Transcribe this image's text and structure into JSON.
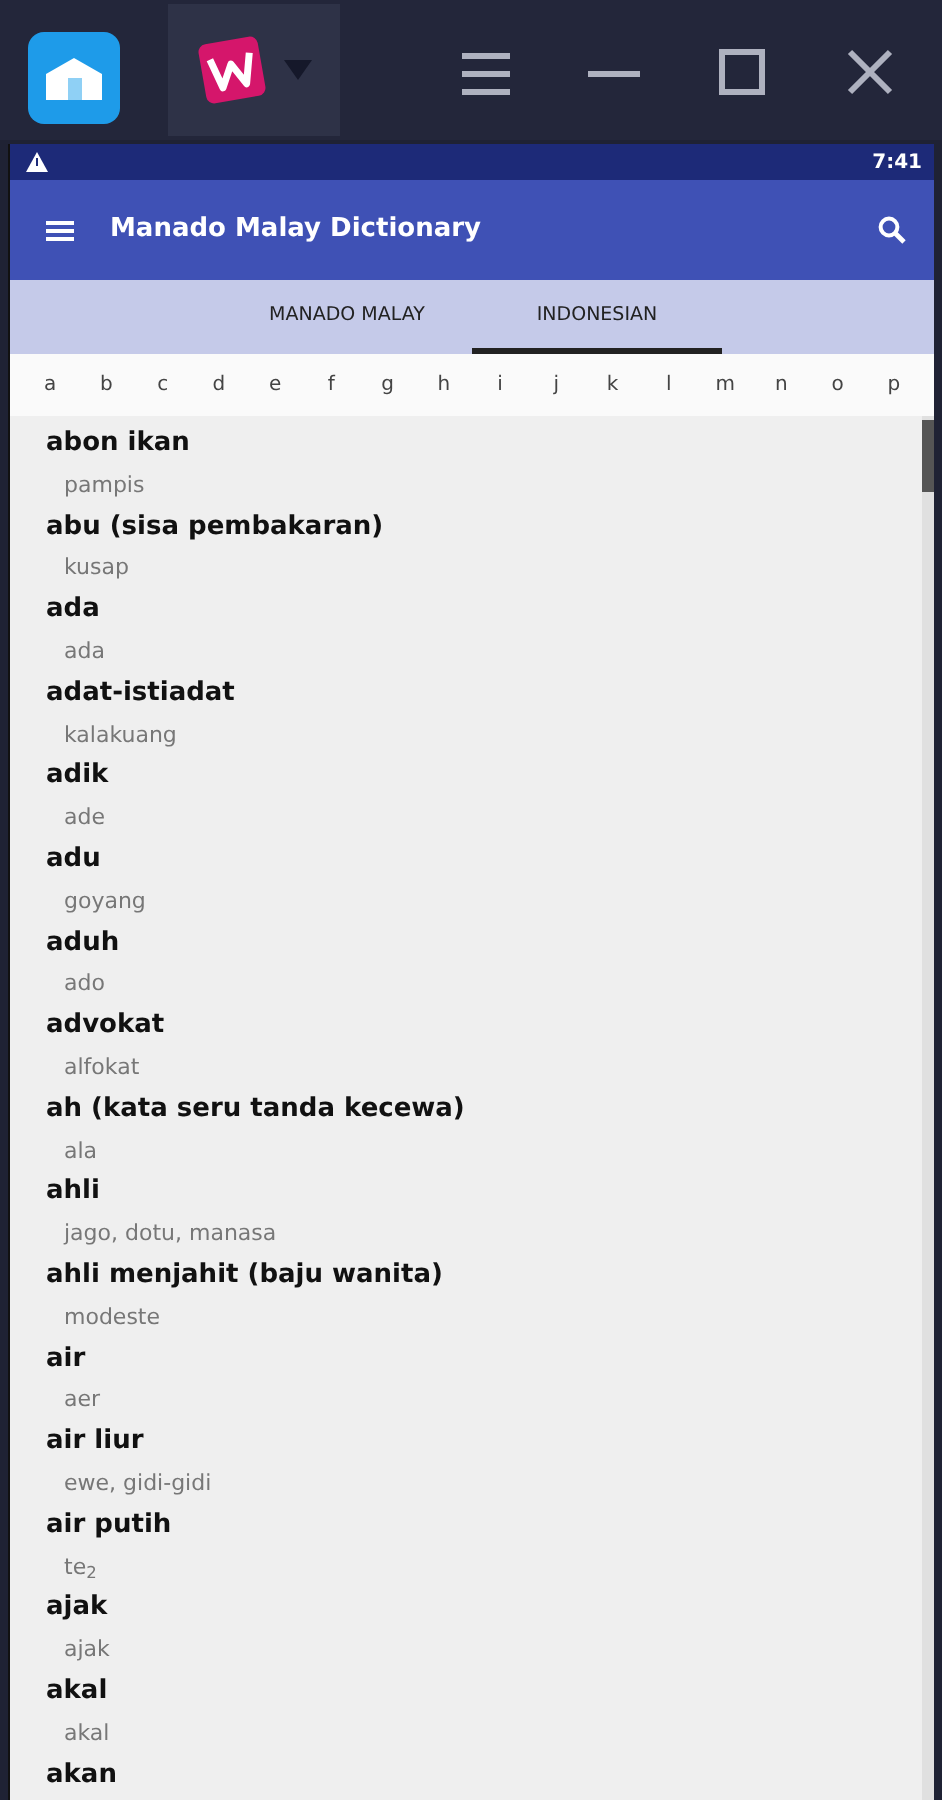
{
  "status_bar": {
    "time": "7:41"
  },
  "app_bar": {
    "title": "Manado Malay Dictionary"
  },
  "tabs": [
    {
      "label": "MANADO MALAY",
      "selected": false
    },
    {
      "label": "INDONESIAN",
      "selected": true
    }
  ],
  "letters": [
    "a",
    "b",
    "c",
    "d",
    "e",
    "f",
    "g",
    "h",
    "i",
    "j",
    "k",
    "l",
    "m",
    "n",
    "o",
    "p"
  ],
  "entries": [
    {
      "word": "abon ikan",
      "translation": "pampis"
    },
    {
      "word": "abu (sisa pembakaran)",
      "translation": "kusap"
    },
    {
      "word": "ada",
      "translation": "ada"
    },
    {
      "word": "adat-istiadat",
      "translation": "kalakuang"
    },
    {
      "word": "adik",
      "translation": "ade"
    },
    {
      "word": "adu",
      "translation": "goyang"
    },
    {
      "word": "aduh",
      "translation": "ado"
    },
    {
      "word": "advokat",
      "translation": "alfokat"
    },
    {
      "word": "ah (kata seru tanda kecewa)",
      "translation": "ala"
    },
    {
      "word": "ahli",
      "translation": "jago, dotu, manasa"
    },
    {
      "word": "ahli menjahit (baju wanita)",
      "translation": "modeste"
    },
    {
      "word": "air",
      "translation": "aer"
    },
    {
      "word": "air liur",
      "translation": "ewe, gidi-gidi"
    },
    {
      "word": "air putih",
      "translation": "te$_{2}$"
    },
    {
      "word": "ajak",
      "translation": "ajak"
    },
    {
      "word": "akal",
      "translation": "akal"
    },
    {
      "word": "akan"
    }
  ]
}
